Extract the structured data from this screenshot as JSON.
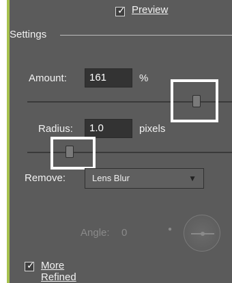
{
  "panel": {
    "preview": {
      "label": "Preview",
      "checked": true
    },
    "settings": {
      "title": "Settings"
    },
    "amount": {
      "label": "Amount:",
      "value": "161",
      "unit": "%"
    },
    "radius": {
      "label": "Radius:",
      "value": "1.0",
      "unit": "pixels"
    },
    "remove": {
      "label": "Remove:",
      "selected": "Lens Blur"
    },
    "angle": {
      "label": "Angle:",
      "value": "0"
    },
    "more_refined": {
      "label": "More Refined",
      "checked": true
    }
  },
  "colors": {
    "panel_bg": "#5b5b5b",
    "accent_left": "#a6c14e",
    "highlight": "#ffffff"
  },
  "icons": {
    "check": "checkmark-icon",
    "dropdown": "chevron-down-icon",
    "angle_dial": "angle-dial-icon"
  }
}
